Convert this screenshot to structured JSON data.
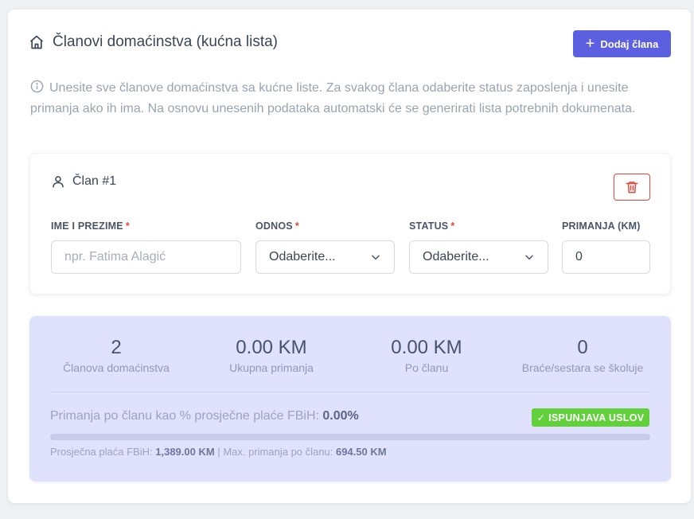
{
  "header": {
    "title": "Članovi domaćinstva (kućna lista)",
    "add_button": "Dodaj člana"
  },
  "info_text": "Unesite sve članove domaćinstva sa kućne liste. Za svakog člana odaberite status zaposlenja i unesite primanja ako ih ima. Na osnovu unesenih podataka automatski će se generirati lista potrebnih dokumenata.",
  "member": {
    "title": "Član #1",
    "fields": {
      "name": {
        "label": "IME I PREZIME",
        "required": "*",
        "placeholder": "npr. Fatima Alagić",
        "value": ""
      },
      "relation": {
        "label": "ODNOS",
        "required": "*",
        "selected": "Odaberite..."
      },
      "status": {
        "label": "STATUS",
        "required": "*",
        "selected": "Odaberite..."
      },
      "income": {
        "label": "PRIMANJA (KM)",
        "value": "0"
      }
    }
  },
  "summary": {
    "stats": [
      {
        "value": "2",
        "label": "Članova domaćinstva"
      },
      {
        "value": "0.00 KM",
        "label": "Ukupna primanja"
      },
      {
        "value": "0.00 KM",
        "label": "Po članu"
      },
      {
        "value": "0",
        "label": "Braće/sestara se školuje"
      }
    ],
    "ratio_label": "Primanja po članu kao % prosječne plaće FBiH:",
    "ratio_value": "0.00%",
    "progress_fraction": 0.0,
    "badge": "✓ ISPUNJAVA USLOV",
    "avg_label": "Prosječna plaća FBiH:",
    "avg_value": "1,389.00 KM",
    "separator": "|",
    "max_label": "Max. primanja po članu:",
    "max_value": "694.50 KM"
  },
  "colors": {
    "accent": "#5b5fe0",
    "danger": "#e0483c",
    "success": "#62d03a",
    "summary_bg": "#dfe1fd"
  },
  "icons": [
    "home-icon",
    "plus-icon",
    "info-icon",
    "user-icon",
    "trash-icon",
    "chevron-down-icon"
  ]
}
